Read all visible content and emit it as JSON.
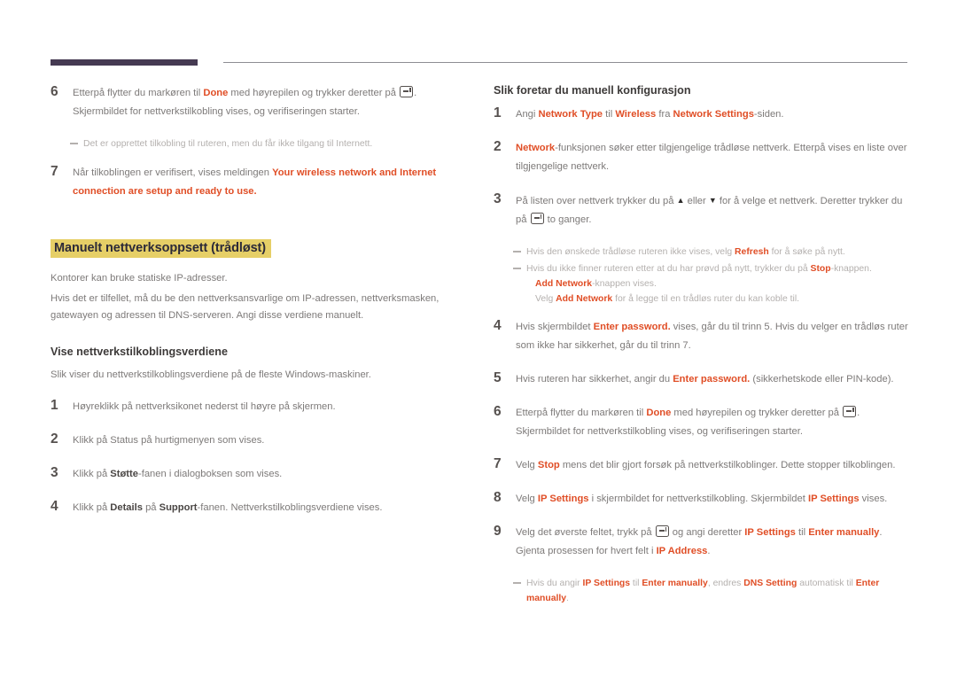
{
  "colors": {
    "accent": "#e04e26",
    "highlight": "#e6cf67",
    "rule_dark": "#453a52",
    "rule_thin": "#8d8d93",
    "body_text": "#7d7a79",
    "heading_text": "#3d3a39",
    "note_text": "#b4b0ae"
  },
  "header": {
    "rule_dark_label": "decorative-bar",
    "rule_thin_label": "header-rule"
  },
  "left_column": {
    "items": [
      {
        "number": "6",
        "parts": [
          {
            "t": "Etterpå flytter du markøren til ",
            "s": "plain"
          },
          {
            "t": "Done",
            "s": "accent"
          },
          {
            "t": " med høyrepilen og trykker deretter på ",
            "s": "plain"
          },
          {
            "t": "",
            "s": "enter-key"
          },
          {
            "t": ". Skjermbildet for nettverkstilkobling vises, og verifiseringen starter.",
            "s": "plain"
          }
        ]
      },
      {
        "number": "7",
        "parts": [
          {
            "t": "Når tilkoblingen er verifisert, vises meldingen ",
            "s": "plain"
          },
          {
            "t": "Your wireless network and Internet connection are setup and ready to use.",
            "s": "accent"
          }
        ]
      }
    ],
    "note_after_6": [
      {
        "t": "Det er opprettet tilkobling til ruteren, men du får ikke tilgang til Internett.",
        "s": "plain"
      }
    ],
    "heading_major": "Manuelt nettverksoppsett (trådløst)",
    "paragraphs": [
      "Kontorer kan bruke statiske IP-adresser.",
      "Hvis det er tilfellet, må du be den nettverksansvarlige om IP-adressen, nettverksmasken, gatewayen og adressen til DNS-serveren. Angi disse verdiene manuelt."
    ],
    "heading_minor": "Vise nettverkstilkoblingsverdiene",
    "intro": "Slik viser du nettverkstilkoblingsverdiene på de fleste Windows-maskiner.",
    "steps": [
      {
        "number": "1",
        "parts": [
          {
            "t": "Høyreklikk på nettverksikonet nederst til høyre på skjermen.",
            "s": "plain"
          }
        ]
      },
      {
        "number": "2",
        "parts": [
          {
            "t": "Klikk på Status på hurtigmenyen som vises.",
            "s": "plain"
          }
        ]
      },
      {
        "number": "3",
        "parts": [
          {
            "t": "Klikk på ",
            "s": "plain"
          },
          {
            "t": "Støtte",
            "s": "dark"
          },
          {
            "t": "-fanen i dialogboksen som vises.",
            "s": "plain"
          }
        ]
      },
      {
        "number": "4",
        "parts": [
          {
            "t": "Klikk på ",
            "s": "plain"
          },
          {
            "t": "Details",
            "s": "dark"
          },
          {
            "t": " på ",
            "s": "plain"
          },
          {
            "t": "Support",
            "s": "dark"
          },
          {
            "t": "-fanen. Nettverkstilkoblingsverdiene vises.",
            "s": "plain"
          }
        ]
      }
    ]
  },
  "right_column": {
    "heading": "Slik foretar du manuell konfigurasjon",
    "steps": [
      {
        "number": "1",
        "parts": [
          {
            "t": "Angi ",
            "s": "plain"
          },
          {
            "t": "Network Type",
            "s": "accent"
          },
          {
            "t": " til ",
            "s": "plain"
          },
          {
            "t": "Wireless",
            "s": "accent"
          },
          {
            "t": " fra ",
            "s": "plain"
          },
          {
            "t": "Network Settings",
            "s": "accent"
          },
          {
            "t": "-siden.",
            "s": "plain"
          }
        ]
      },
      {
        "number": "2",
        "parts": [
          {
            "t": "Network",
            "s": "accent"
          },
          {
            "t": "-funksjonen søker etter tilgjengelige trådløse nettverk. Etterpå vises en liste over tilgjengelige nettverk.",
            "s": "plain"
          }
        ]
      },
      {
        "number": "3",
        "parts": [
          {
            "t": "På listen over nettverk trykker du på ",
            "s": "plain"
          },
          {
            "t": "▲",
            "s": "triangle"
          },
          {
            "t": " eller ",
            "s": "plain"
          },
          {
            "t": "▼",
            "s": "triangle"
          },
          {
            "t": " for å velge et nettverk. Deretter trykker du på ",
            "s": "plain"
          },
          {
            "t": "",
            "s": "enter-key"
          },
          {
            "t": " to ganger.",
            "s": "plain"
          }
        ]
      },
      {
        "number": "4",
        "parts": [
          {
            "t": "Hvis skjermbildet ",
            "s": "plain"
          },
          {
            "t": "Enter password.",
            "s": "accent"
          },
          {
            "t": " vises, går du til trinn 5. Hvis du velger en trådløs ruter som ikke har sikkerhet, går du til trinn 7.",
            "s": "plain"
          }
        ]
      },
      {
        "number": "5",
        "parts": [
          {
            "t": "Hvis ruteren har sikkerhet, angir du ",
            "s": "plain"
          },
          {
            "t": "Enter password.",
            "s": "accent"
          },
          {
            "t": " (sikkerhetskode eller PIN-kode).",
            "s": "plain"
          }
        ]
      },
      {
        "number": "6",
        "parts": [
          {
            "t": "Etterpå flytter du markøren til ",
            "s": "plain"
          },
          {
            "t": "Done",
            "s": "accent"
          },
          {
            "t": " med høyrepilen og trykker deretter på ",
            "s": "plain"
          },
          {
            "t": "",
            "s": "enter-key"
          },
          {
            "t": ". Skjermbildet for nettverkstilkobling vises, og verifiseringen starter.",
            "s": "plain"
          }
        ]
      },
      {
        "number": "7",
        "parts": [
          {
            "t": "Velg ",
            "s": "plain"
          },
          {
            "t": "Stop",
            "s": "accent"
          },
          {
            "t": " mens det blir gjort forsøk på nettverkstilkoblinger. Dette stopper tilkoblingen.",
            "s": "plain"
          }
        ]
      },
      {
        "number": "8",
        "parts": [
          {
            "t": "Velg ",
            "s": "plain"
          },
          {
            "t": "IP Settings",
            "s": "accent"
          },
          {
            "t": " i skjermbildet for nettverkstilkobling. Skjermbildet ",
            "s": "plain"
          },
          {
            "t": "IP Settings",
            "s": "accent"
          },
          {
            "t": " vises.",
            "s": "plain"
          }
        ]
      },
      {
        "number": "9",
        "parts": [
          {
            "t": "Velg det øverste feltet, trykk på ",
            "s": "plain"
          },
          {
            "t": "",
            "s": "enter-key"
          },
          {
            "t": " og angi deretter ",
            "s": "plain"
          },
          {
            "t": "IP Settings",
            "s": "accent"
          },
          {
            "t": " til ",
            "s": "plain"
          },
          {
            "t": "Enter manually",
            "s": "accent"
          },
          {
            "t": ". Gjenta prosessen for hvert felt i ",
            "s": "plain"
          },
          {
            "t": "IP Address",
            "s": "accent"
          },
          {
            "t": ".",
            "s": "plain"
          }
        ]
      }
    ],
    "notes_after_3": [
      {
        "parts": [
          {
            "t": "Hvis den ønskede trådløse ruteren ikke vises, velg ",
            "s": "plain"
          },
          {
            "t": "Refresh",
            "s": "accent"
          },
          {
            "t": " for å søke på nytt.",
            "s": "plain"
          }
        ],
        "sub": []
      },
      {
        "parts": [
          {
            "t": "Hvis du ikke finner ruteren etter at du har prøvd på nytt, trykker du på ",
            "s": "plain"
          },
          {
            "t": "Stop",
            "s": "accent"
          },
          {
            "t": "-knappen.",
            "s": "plain"
          }
        ],
        "sub": [
          [
            {
              "t": "Add Network",
              "s": "accent"
            },
            {
              "t": "-knappen vises.",
              "s": "plain"
            }
          ],
          [
            {
              "t": "Velg ",
              "s": "plain"
            },
            {
              "t": "Add Network",
              "s": "accent"
            },
            {
              "t": " for å legge til en trådløs ruter du kan koble til.",
              "s": "plain"
            }
          ]
        ]
      }
    ],
    "note_after_9": {
      "parts": [
        {
          "t": "Hvis du angir ",
          "s": "plain"
        },
        {
          "t": "IP Settings",
          "s": "accent"
        },
        {
          "t": " til ",
          "s": "plain"
        },
        {
          "t": "Enter manually",
          "s": "accent"
        },
        {
          "t": ", endres ",
          "s": "plain"
        },
        {
          "t": "DNS Setting",
          "s": "accent"
        },
        {
          "t": " automatisk til ",
          "s": "plain"
        },
        {
          "t": "Enter manually",
          "s": "accent"
        },
        {
          "t": ".",
          "s": "plain"
        }
      ]
    }
  }
}
